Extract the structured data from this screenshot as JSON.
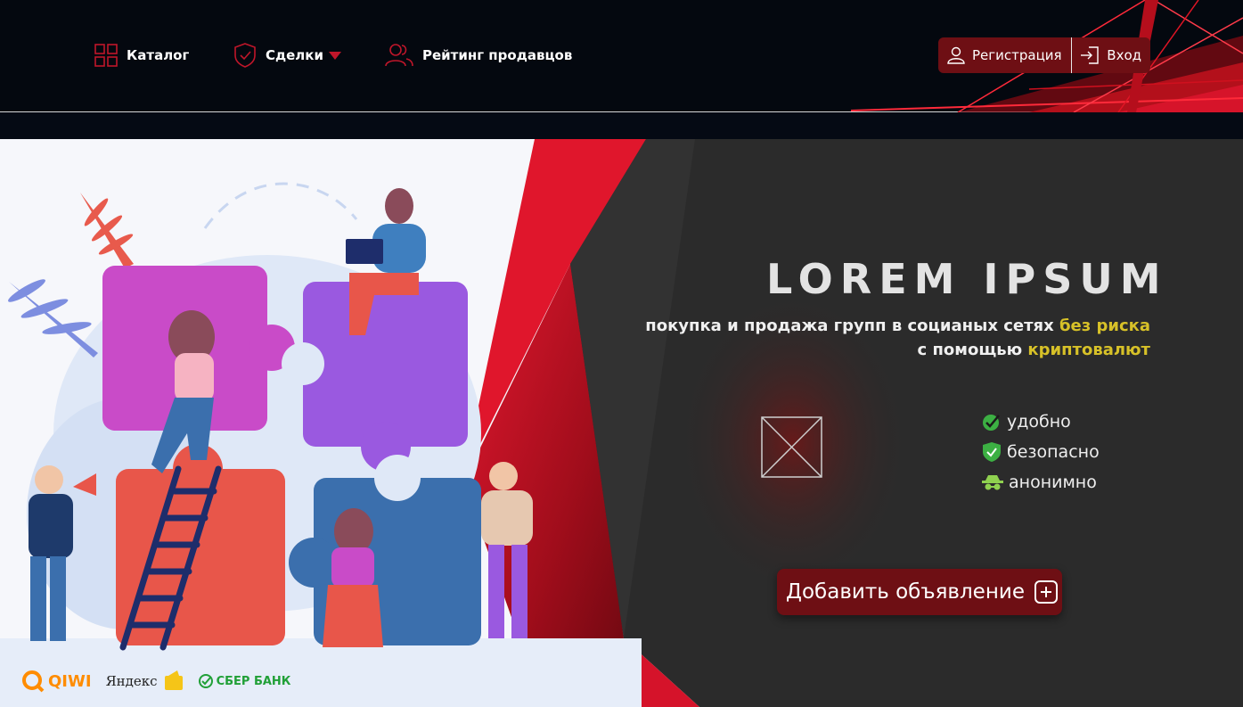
{
  "nav": {
    "catalog": "Каталог",
    "deals": "Сделки",
    "rating": "Рейтинг продавцов"
  },
  "auth": {
    "register": "Регистрация",
    "login": "Вход"
  },
  "hero": {
    "title": "LOREM IPSUM",
    "subtitle_part1": "покупка и продажа групп в социаных сетях ",
    "subtitle_hl1": "без риска",
    "subtitle_part2": "с помощью ",
    "subtitle_hl2": "криптовалют",
    "features": [
      {
        "label": "удобно",
        "icon": "check-icon"
      },
      {
        "label": "безопасно",
        "icon": "shield-check-icon"
      },
      {
        "label": "анонимно",
        "icon": "incognito-icon"
      }
    ],
    "add_button": "Добавить объявление"
  },
  "payments": {
    "qiwi": "QIWI",
    "yandex": "Яндекс",
    "sber": "СБЕР БАНК"
  },
  "colors": {
    "background": "#04080f",
    "accent_red": "#6e0f14",
    "highlight_yellow": "#d7c128",
    "hero_dark": "#2a2a2a"
  }
}
